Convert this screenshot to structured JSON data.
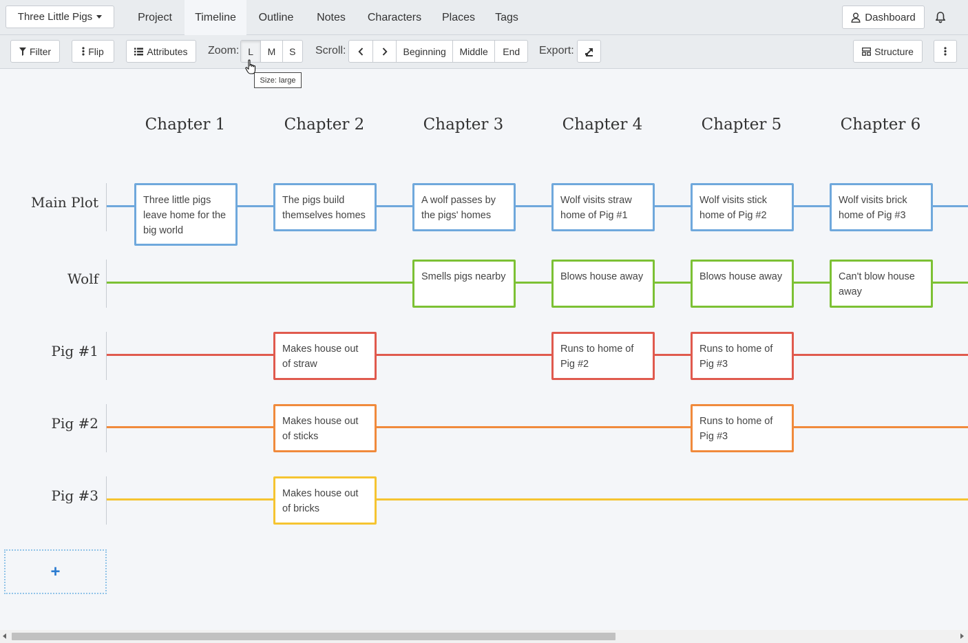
{
  "nav": {
    "project_name": "Three Little Pigs",
    "tabs": [
      {
        "label": "Project"
      },
      {
        "label": "Timeline"
      },
      {
        "label": "Outline"
      },
      {
        "label": "Notes"
      },
      {
        "label": "Characters"
      },
      {
        "label": "Places"
      },
      {
        "label": "Tags"
      }
    ],
    "active_tab": "Timeline",
    "dashboard_label": "Dashboard"
  },
  "toolbar": {
    "filter_label": "Filter",
    "flip_label": "Flip",
    "attributes_label": "Attributes",
    "zoom_label": "Zoom:",
    "zoom_options": [
      "L",
      "M",
      "S"
    ],
    "zoom_selected": "L",
    "scroll_label": "Scroll:",
    "scroll_beginning": "Beginning",
    "scroll_middle": "Middle",
    "scroll_end": "End",
    "export_label": "Export:",
    "structure_label": "Structure",
    "tooltip": "Size: large"
  },
  "timeline": {
    "chapters": [
      "Chapter 1",
      "Chapter 2",
      "Chapter 3",
      "Chapter 4",
      "Chapter 5",
      "Chapter 6"
    ],
    "rows": [
      {
        "label": "Main Plot",
        "color": "#6fa8dc"
      },
      {
        "label": "Wolf",
        "color": "#7cc134"
      },
      {
        "label": "Pig #1",
        "color": "#e05a4e"
      },
      {
        "label": "Pig #2",
        "color": "#f08a3c"
      },
      {
        "label": "Pig #3",
        "color": "#f5c431"
      }
    ],
    "cards": {
      "main_1": "Three little pigs leave home for the big world",
      "main_2": "The pigs build themselves homes",
      "main_3": "A wolf passes by the pigs' homes",
      "main_4": "Wolf visits straw home of Pig #1",
      "main_5": "Wolf visits stick home of Pig #2",
      "main_6": "Wolf visits brick home of Pig #3",
      "wolf_3": "Smells pigs nearby",
      "wolf_4": "Blows house away",
      "wolf_5": "Blows house away",
      "wolf_6": "Can't blow house away",
      "pig1_2": "Makes house out of straw",
      "pig1_4": "Runs to home of Pig #2",
      "pig1_5": "Runs to home of Pig #3",
      "pig2_2": "Makes house out of sticks",
      "pig2_5": "Runs to home of Pig #3",
      "pig3_2": "Makes house out of bricks"
    },
    "add_label": "+"
  }
}
